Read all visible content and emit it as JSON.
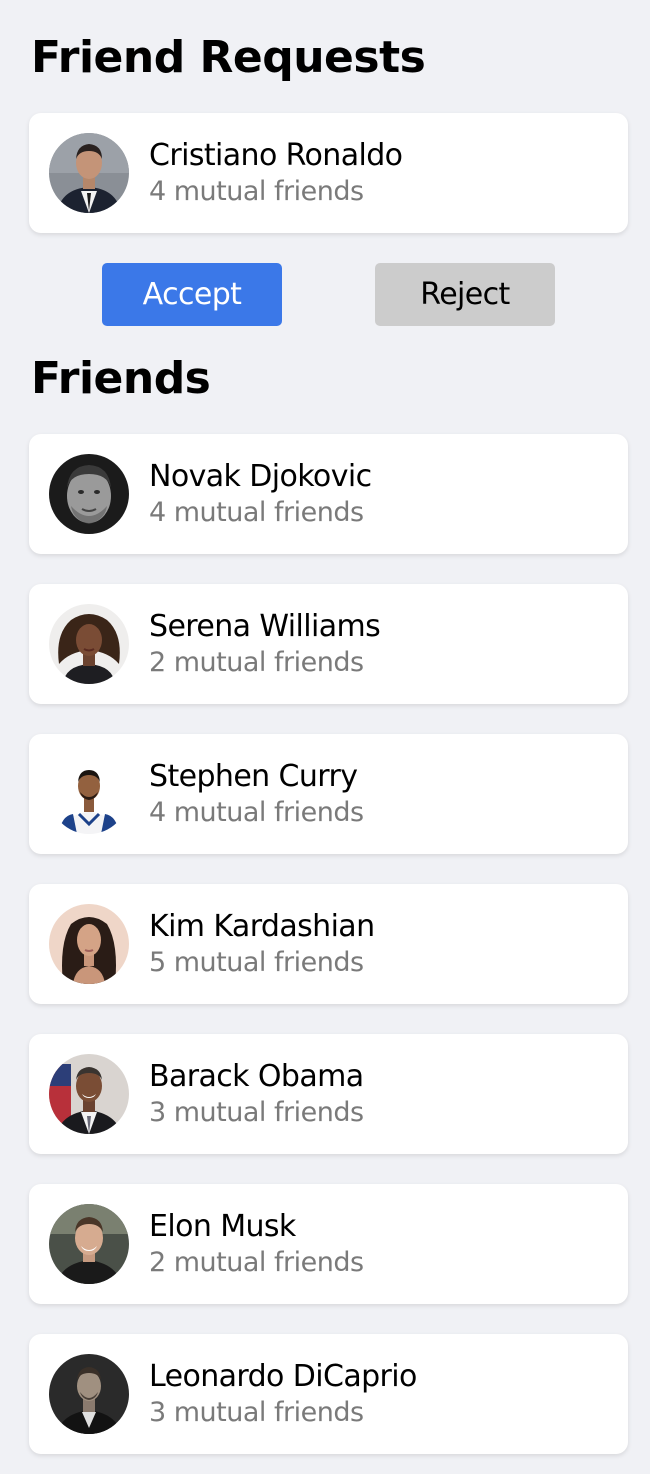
{
  "friend_requests": {
    "title": "Friend Requests",
    "items": [
      {
        "name": "Cristiano Ronaldo",
        "mutual": "4 mutual friends",
        "avatar": "avatar-cristiano-ronaldo"
      }
    ],
    "accept_label": "Accept",
    "reject_label": "Reject"
  },
  "friends": {
    "title": "Friends",
    "items": [
      {
        "name": "Novak Djokovic",
        "mutual": "4 mutual friends",
        "avatar": "avatar-novak-djokovic"
      },
      {
        "name": "Serena Williams",
        "mutual": "2 mutual friends",
        "avatar": "avatar-serena-williams"
      },
      {
        "name": "Stephen Curry",
        "mutual": "4 mutual friends",
        "avatar": "avatar-stephen-curry"
      },
      {
        "name": "Kim Kardashian",
        "mutual": "5 mutual friends",
        "avatar": "avatar-kim-kardashian"
      },
      {
        "name": "Barack Obama",
        "mutual": "3 mutual friends",
        "avatar": "avatar-barack-obama"
      },
      {
        "name": "Elon Musk",
        "mutual": "2 mutual friends",
        "avatar": "avatar-elon-musk"
      },
      {
        "name": "Leonardo DiCaprio",
        "mutual": "3 mutual friends",
        "avatar": "avatar-leonardo-dicaprio"
      }
    ]
  },
  "colors": {
    "background": "#f0f1f5",
    "accept_button": "#3b78e8",
    "reject_button": "#cccccc",
    "secondary_text": "#7a7a7a"
  }
}
